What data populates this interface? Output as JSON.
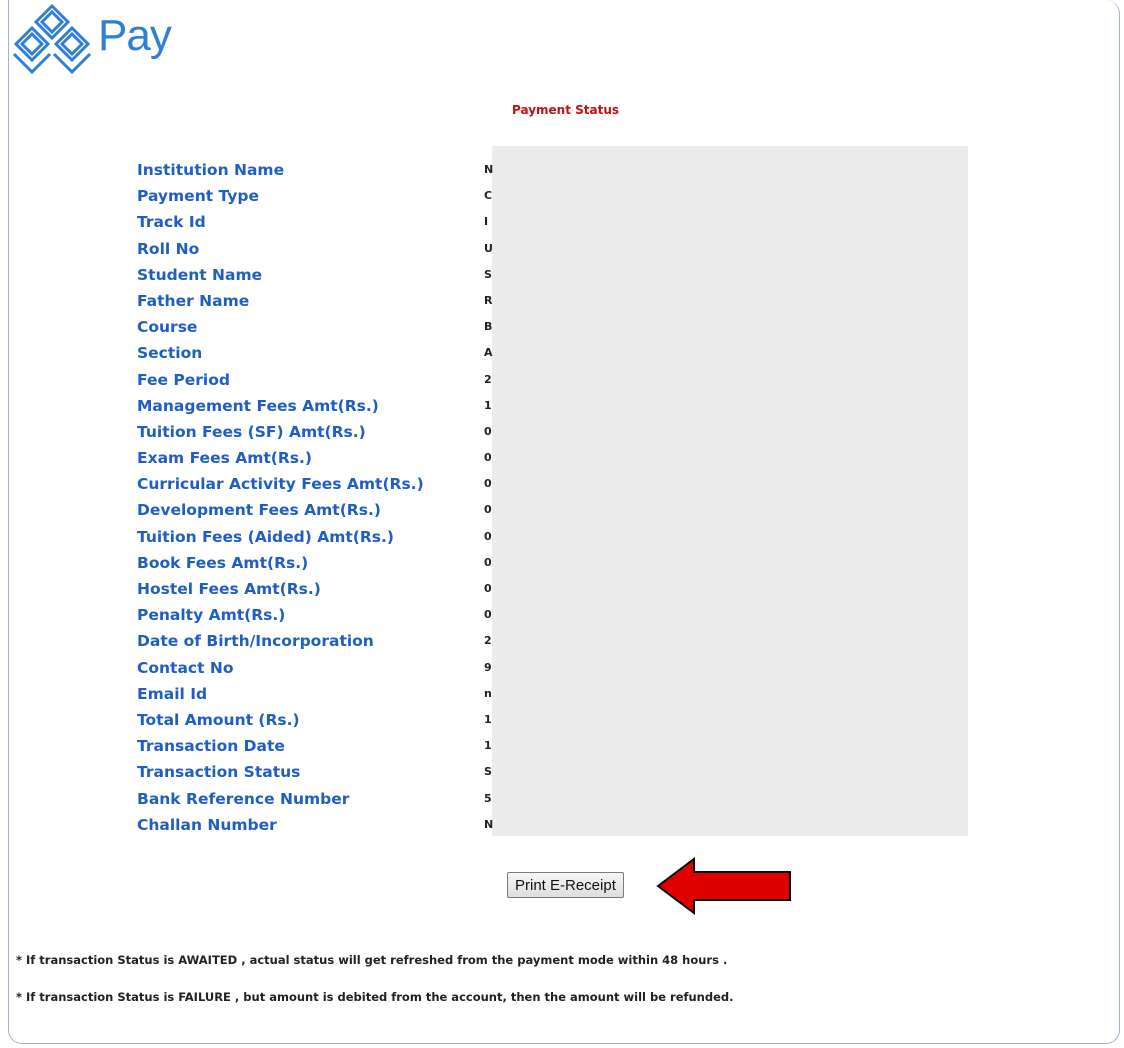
{
  "header": {
    "logo_text": "Pay",
    "logo_icon": "diamond-stack-logo-icon"
  },
  "page": {
    "title": "Payment Status"
  },
  "details": {
    "labels": [
      "Institution Name",
      "Payment Type",
      "Track Id",
      "Roll No",
      "Student Name",
      "Father Name",
      "Course",
      "Section",
      "Fee Period",
      "Management Fees Amt(Rs.)",
      "Tuition Fees (SF) Amt(Rs.)",
      "Exam Fees Amt(Rs.)",
      "Curricular Activity Fees Amt(Rs.)",
      "Development Fees Amt(Rs.)",
      "Tuition Fees (Aided) Amt(Rs.)",
      "Book Fees Amt(Rs.)",
      "Hostel Fees Amt(Rs.)",
      "Penalty Amt(Rs.)",
      "Date of Birth/Incorporation",
      "Contact No",
      "Email Id",
      "Total Amount (Rs.)",
      "Transaction Date",
      "Transaction Status",
      "Bank Reference Number",
      "Challan Number"
    ],
    "values": [
      "N",
      "C",
      "I",
      "U",
      "S",
      "R",
      "B",
      "A",
      "2",
      "1",
      "0",
      "0",
      "0",
      "0",
      "0",
      "0",
      "0",
      "0",
      "2",
      "9",
      "n",
      "1",
      "1",
      "S",
      "5",
      "N"
    ]
  },
  "actions": {
    "print_label": "Print E-Receipt",
    "pointer_icon": "red-arrow-left-icon"
  },
  "notes": [
    "* If transaction Status is AWAITED , actual status will get refreshed from the payment mode within 48 hours .",
    "* If transaction Status is FAILURE , but amount is debited from the account, then the amount will be refunded."
  ],
  "colors": {
    "label": "#1f5fc2",
    "title": "#c01010",
    "arrow": "#e00000",
    "logo": "#2f7fd6"
  }
}
